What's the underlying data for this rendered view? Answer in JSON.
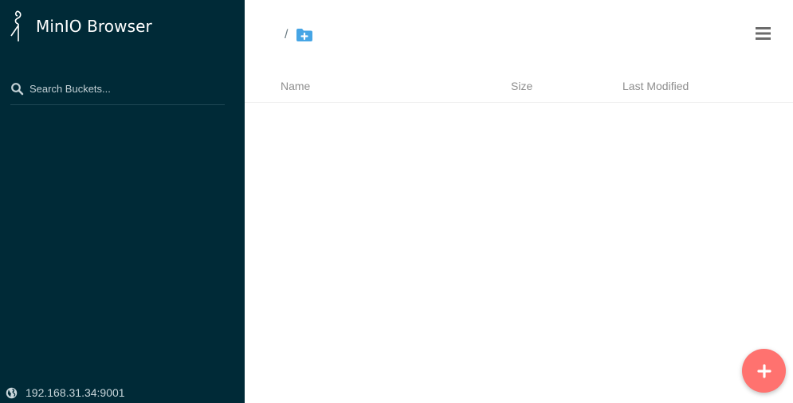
{
  "sidebar": {
    "brand": {
      "name": "MinIO Browser",
      "logo_icon": "minio-logo-icon"
    },
    "search": {
      "placeholder": "Search Buckets...",
      "value": "",
      "icon": "search-icon"
    },
    "host": {
      "address": "192.168.31.34:9001",
      "icon": "globe-icon"
    }
  },
  "main": {
    "breadcrumb": {
      "separator": "/"
    },
    "actions": {
      "new_folder_icon": "folder-plus-icon",
      "menu_icon": "hamburger-menu-icon"
    },
    "table": {
      "columns": [
        "Name",
        "Size",
        "Last Modified"
      ],
      "rows": []
    },
    "fab": {
      "label": "+",
      "icon": "plus-icon"
    }
  },
  "colors": {
    "sidebar_bg": "#002a37",
    "accent_folder": "#46a5e5",
    "fab": "#ff726f",
    "header_text": "#8e8e8e"
  }
}
